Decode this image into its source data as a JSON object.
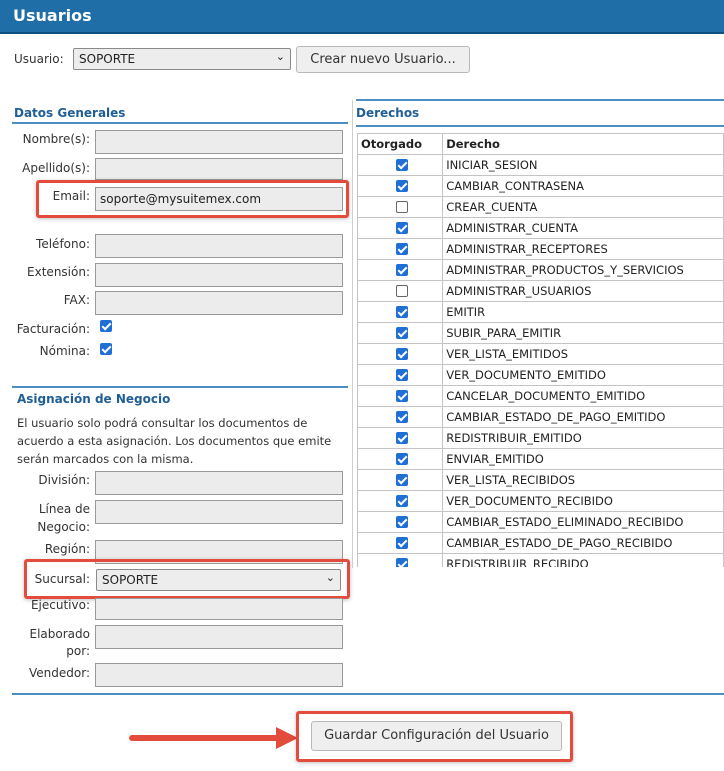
{
  "window": {
    "title": "Usuarios"
  },
  "user_selector": {
    "label": "Usuario:",
    "selected": "SOPORTE",
    "create_button": "Crear nuevo Usuario..."
  },
  "datos_generales": {
    "title": "Datos Generales",
    "nombre_label": "Nombre(s):",
    "nombre_value": "",
    "apellido_label": "Apellido(s):",
    "apellido_value": "",
    "email_label": "Email:",
    "email_value": "soporte@mysuitemex.com",
    "telefono_label": "Teléfono:",
    "telefono_value": "",
    "extension_label": "Extensión:",
    "extension_value": "",
    "fax_label": "FAX:",
    "fax_value": "",
    "facturacion_label": "Facturación:",
    "facturacion_checked": true,
    "nomina_label": "Nómina:",
    "nomina_checked": true
  },
  "asignacion": {
    "title": "Asignación de Negocio",
    "note": "El usuario solo podrá consultar los documentos de acuerdo a esta asignación. Los documentos que emite serán marcados con la misma.",
    "division_label": "División:",
    "linea_label_1": "Línea de",
    "linea_label_2": "Negocio:",
    "region_label": "Región:",
    "sucursal_label": "Sucursal:",
    "sucursal_selected": "SOPORTE",
    "ejecutivo_label": "Ejecutivo:",
    "elaborado_label_1": "Elaborado",
    "elaborado_label_2": "por:",
    "vendedor_label": "Vendedor:"
  },
  "derechos": {
    "title": "Derechos",
    "col_otorgado": "Otorgado",
    "col_derecho": "Derecho",
    "rows": [
      {
        "name": "INICIAR_SESION",
        "granted": true
      },
      {
        "name": "CAMBIAR_CONTRASENA",
        "granted": true
      },
      {
        "name": "CREAR_CUENTA",
        "granted": false
      },
      {
        "name": "ADMINISTRAR_CUENTA",
        "granted": true
      },
      {
        "name": "ADMINISTRAR_RECEPTORES",
        "granted": true
      },
      {
        "name": "ADMINISTRAR_PRODUCTOS_Y_SERVICIOS",
        "granted": true
      },
      {
        "name": "ADMINISTRAR_USUARIOS",
        "granted": false
      },
      {
        "name": "EMITIR",
        "granted": true
      },
      {
        "name": "SUBIR_PARA_EMITIR",
        "granted": true
      },
      {
        "name": "VER_LISTA_EMITIDOS",
        "granted": true
      },
      {
        "name": "VER_DOCUMENTO_EMITIDO",
        "granted": true
      },
      {
        "name": "CANCELAR_DOCUMENTO_EMITIDO",
        "granted": true
      },
      {
        "name": "CAMBIAR_ESTADO_DE_PAGO_EMITIDO",
        "granted": true
      },
      {
        "name": "REDISTRIBUIR_EMITIDO",
        "granted": true
      },
      {
        "name": "ENVIAR_EMITIDO",
        "granted": true
      },
      {
        "name": "VER_LISTA_RECIBIDOS",
        "granted": true
      },
      {
        "name": "VER_DOCUMENTO_RECIBIDO",
        "granted": true
      },
      {
        "name": "CAMBIAR_ESTADO_ELIMINADO_RECIBIDO",
        "granted": true
      },
      {
        "name": "CAMBIAR_ESTADO_DE_PAGO_RECIBIDO",
        "granted": true
      },
      {
        "name": "REDISTRIBUIR_RECIBIDO",
        "granted": true
      }
    ]
  },
  "footer": {
    "save_button": "Guardar Configuración del Usuario"
  },
  "colors": {
    "header_bg": "#1f6ea8",
    "section_text": "#1f5f96",
    "rule": "#4d8fc2",
    "highlight": "#e34b3c",
    "checkbox": "#1f6fd6"
  }
}
